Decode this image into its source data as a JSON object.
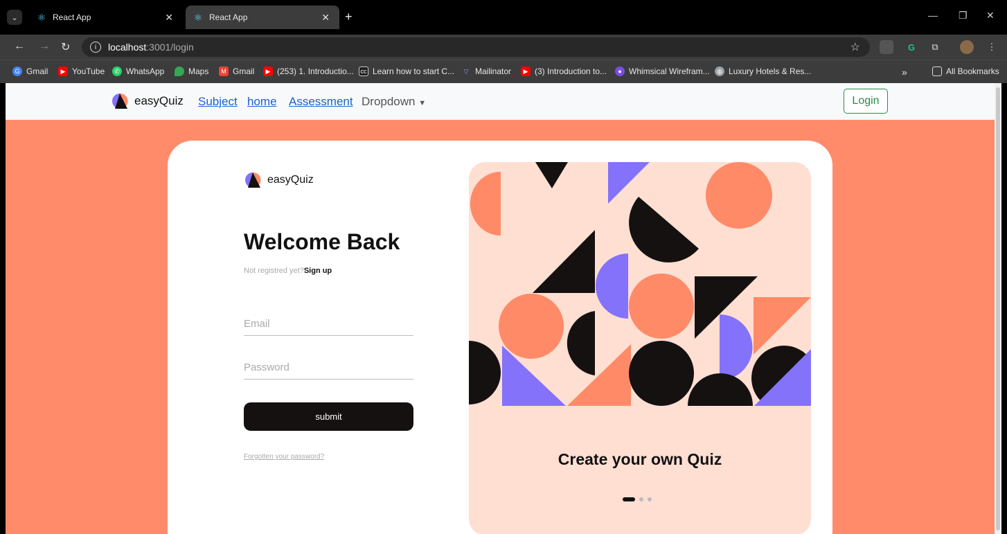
{
  "browser": {
    "tabs": [
      {
        "title": "React App",
        "active": false
      },
      {
        "title": "React App",
        "active": true
      }
    ],
    "url_host": "localhost",
    "url_path": ":3001/login",
    "bookmarks": [
      {
        "label": "Gmail",
        "icon": "google-icon",
        "color": "#4285f4"
      },
      {
        "label": "YouTube",
        "icon": "youtube-icon",
        "color": "#ff0000"
      },
      {
        "label": "WhatsApp",
        "icon": "whatsapp-icon",
        "color": "#25d366"
      },
      {
        "label": "Maps",
        "icon": "maps-icon",
        "color": "#34a853"
      },
      {
        "label": "Gmail",
        "icon": "gmail-icon",
        "color": "#ea4335"
      },
      {
        "label": "(253) 1. Introductio...",
        "icon": "youtube-icon",
        "color": "#ff0000"
      },
      {
        "label": "Learn how to start C...",
        "icon": "cc-icon",
        "color": "#1f1f1f"
      },
      {
        "label": "Mailinator",
        "icon": "mailinator-icon",
        "color": "#6b7bd6"
      },
      {
        "label": "(3) Introduction to...",
        "icon": "youtube-icon",
        "color": "#ff0000"
      },
      {
        "label": "Whimsical Wirefram...",
        "icon": "whimsical-icon",
        "color": "#7b4de0"
      },
      {
        "label": "Luxury Hotels & Res...",
        "icon": "globe-icon",
        "color": "#9aa0a6"
      }
    ],
    "all_bookmarks": "All Bookmarks",
    "overflow": "»"
  },
  "navbar": {
    "brand": "easyQuiz",
    "links": [
      "Subject",
      "home",
      "Assessment"
    ],
    "dropdown": "Dropdown",
    "login": "Login"
  },
  "login": {
    "brand": "easyQuiz",
    "heading": "Welcome Back",
    "not_registered": "Not registred yet?",
    "signup": "Sign up",
    "email_placeholder": "Email",
    "password_placeholder": "Password",
    "submit": "submit",
    "forgot": "Forgotten your password?"
  },
  "hero": {
    "caption": "Create your own Quiz",
    "slides": 3,
    "active_slide": 0
  },
  "colors": {
    "page_bg": "#ff8b6a",
    "panel_bg": "#ffdfd2",
    "purple": "#8472fa",
    "coral": "#ff8a67",
    "black": "#151111",
    "login_green": "#2a8a4a"
  }
}
